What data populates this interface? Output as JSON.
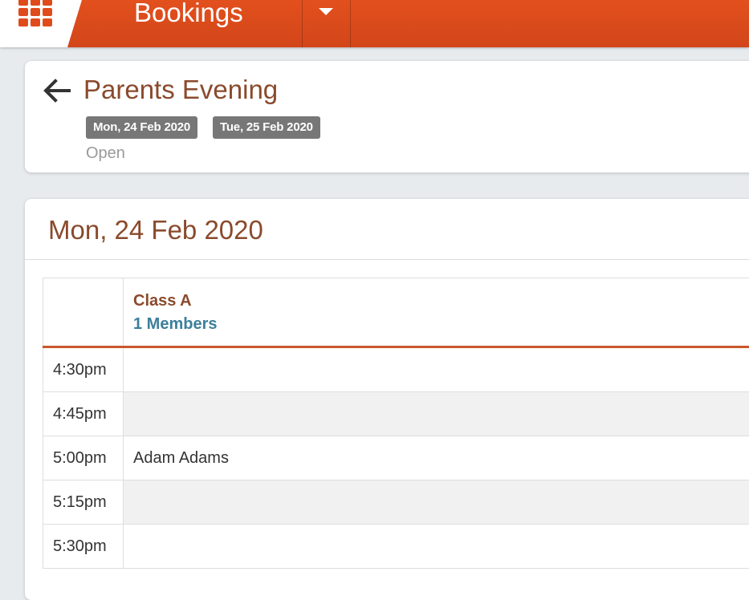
{
  "topbar": {
    "app_title": "Bookings",
    "menu_icon": "grid-icon",
    "dropdown_icon": "chevron-down-icon",
    "accent": "#e04b1b"
  },
  "header": {
    "back_icon": "arrow-left-icon",
    "title": "Parents Evening",
    "dates": [
      "Mon, 24 Feb 2020",
      "Tue, 25 Feb 2020"
    ],
    "status": "Open"
  },
  "day": {
    "title": "Mon, 24 Feb 2020",
    "column": {
      "name": "Class A",
      "members": "1 Members"
    },
    "slots": [
      {
        "time": "4:30pm",
        "booking": ""
      },
      {
        "time": "4:45pm",
        "booking": ""
      },
      {
        "time": "5:00pm",
        "booking": "Adam Adams"
      },
      {
        "time": "5:15pm",
        "booking": ""
      },
      {
        "time": "5:30pm",
        "booking": ""
      }
    ]
  }
}
